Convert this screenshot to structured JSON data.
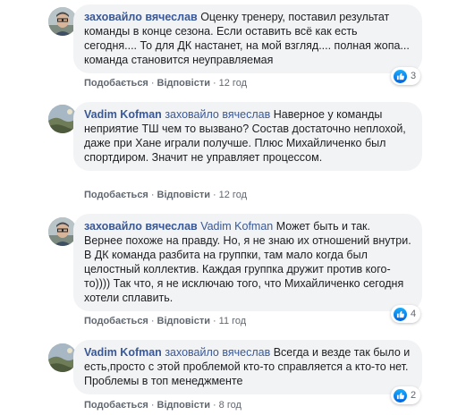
{
  "comments": [
    {
      "author": "заховайло вячеслав",
      "mention": "",
      "text": "Оценку тренеру, поставил результат команды в конце сезона. Если оставить всё как есть сегодня.... То для ДК настанет, на мой взгляд.... полная жопа... команда становится неуправляемая",
      "like_label": "Подобається",
      "reply_label": "Відповісти",
      "time": "12 год",
      "reactions": "3",
      "avatar": "avatar-photo-man-glasses"
    },
    {
      "author": "Vadim Kofman",
      "mention": "заховайло вячеслав",
      "text": "Наверное у команды неприятие ТШ чем то вызвано? Состав достаточно неплохой, даже при Хане играли получше. Плюс Михайличенко был спортдиром. Значит не управляет процессом.",
      "like_label": "Подобається",
      "reply_label": "Відповісти",
      "time": "12 год",
      "reactions": "",
      "avatar": "avatar-photo-landscape"
    },
    {
      "author": "заховайло вячеслав",
      "mention": "Vadim Kofman",
      "text": "Может быть и так. Вернее похоже на правду. Но, я не знаю их отношений внутри. В ДК команда разбита на группки, там мало когда был целостный коллектив. Каждая группка дружит против кого-то)))) Так что, я не исключаю того, что Михайличенко сегодня хотели сплавить.",
      "like_label": "Подобається",
      "reply_label": "Відповісти",
      "time": "11 год",
      "reactions": "4",
      "avatar": "avatar-photo-man-glasses"
    },
    {
      "author": "Vadim Kofman",
      "mention": "заховайло вячеслав",
      "text": "Всегда и везде так было и есть,просто с этой проблемой кто-то справляется а кто-то нет. Проблемы в топ менеджменте",
      "like_label": "Подобається",
      "reply_label": "Відповісти",
      "time": "8 год",
      "reactions": "2",
      "avatar": "avatar-photo-landscape"
    }
  ],
  "colors": {
    "link": "#385898",
    "bubble": "#f2f3f5",
    "like": "#1877f2"
  }
}
